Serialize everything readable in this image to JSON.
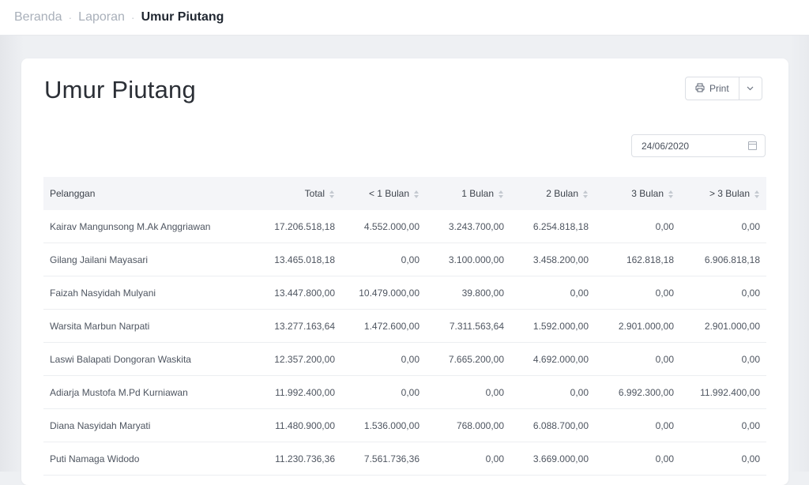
{
  "breadcrumb": {
    "items": [
      "Beranda",
      "Laporan"
    ],
    "current": "Umur Piutang"
  },
  "page": {
    "title": "Umur Piutang",
    "print_label": "Print",
    "date_value": "24/06/2020"
  },
  "table": {
    "headers": [
      "Pelanggan",
      "Total",
      "< 1 Bulan",
      "1 Bulan",
      "2 Bulan",
      "3 Bulan",
      "> 3 Bulan"
    ],
    "rows": [
      [
        "Kairav Mangunsong M.Ak Anggriawan",
        "17.206.518,18",
        "4.552.000,00",
        "3.243.700,00",
        "6.254.818,18",
        "0,00",
        "0,00"
      ],
      [
        "Gilang Jailani Mayasari",
        "13.465.018,18",
        "0,00",
        "3.100.000,00",
        "3.458.200,00",
        "162.818,18",
        "6.906.818,18"
      ],
      [
        "Faizah Nasyidah Mulyani",
        "13.447.800,00",
        "10.479.000,00",
        "39.800,00",
        "0,00",
        "0,00",
        "0,00"
      ],
      [
        "Warsita Marbun Narpati",
        "13.277.163,64",
        "1.472.600,00",
        "7.311.563,64",
        "1.592.000,00",
        "2.901.000,00",
        "2.901.000,00"
      ],
      [
        "Laswi Balapati Dongoran Waskita",
        "12.357.200,00",
        "0,00",
        "7.665.200,00",
        "4.692.000,00",
        "0,00",
        "0,00"
      ],
      [
        "Adiarja Mustofa M.Pd Kurniawan",
        "11.992.400,00",
        "0,00",
        "0,00",
        "0,00",
        "6.992.300,00",
        "11.992.400,00"
      ],
      [
        "Diana Nasyidah Maryati",
        "11.480.900,00",
        "1.536.000,00",
        "768.000,00",
        "6.088.700,00",
        "0,00",
        "0,00"
      ],
      [
        "Puti Namaga Widodo",
        "11.230.736,36",
        "7.561.736,36",
        "0,00",
        "3.669.000,00",
        "0,00",
        "0,00"
      ]
    ]
  }
}
